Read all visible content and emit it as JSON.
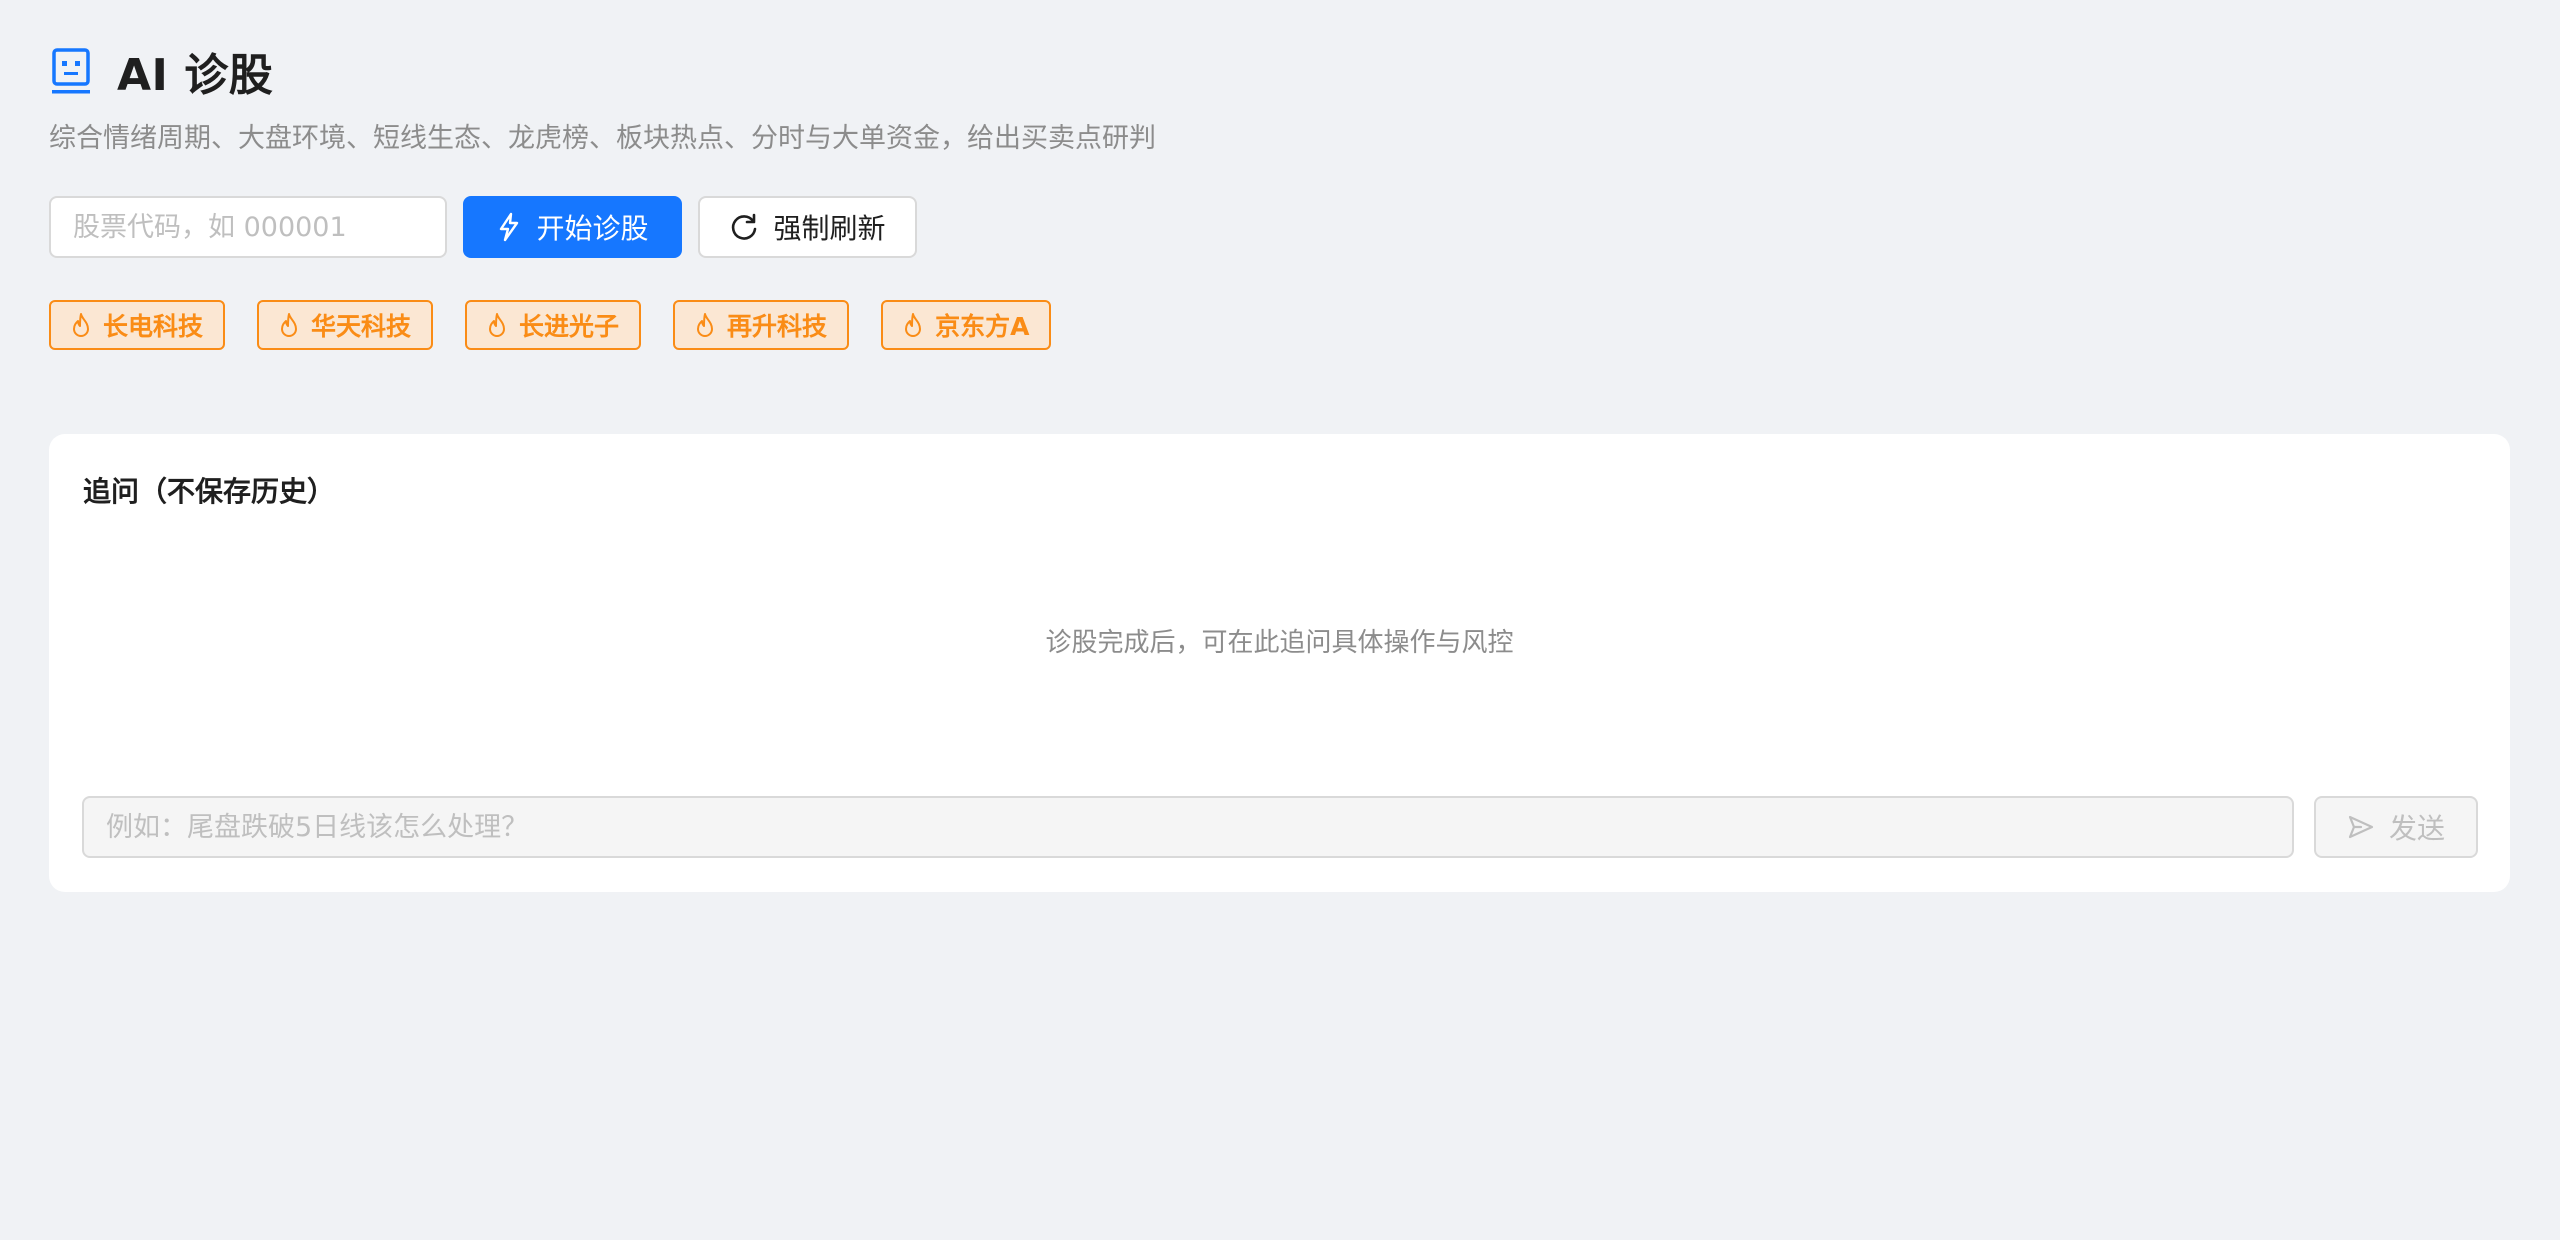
{
  "header": {
    "title": "AI 诊股",
    "logo_icon": "robot-icon",
    "subtitle": "综合情绪周期、大盘环境、短线生态、龙虎榜、板块热点、分时与大单资金，给出买卖点研判"
  },
  "controls": {
    "code_input": {
      "value": "",
      "placeholder": "股票代码，如 000001"
    },
    "start_button": {
      "label": "开始诊股",
      "icon": "lightning-icon"
    },
    "refresh_button": {
      "label": "强制刷新",
      "icon": "reload-icon"
    }
  },
  "hot_stocks": {
    "icon": "fire-icon",
    "items": [
      {
        "label": "长电科技"
      },
      {
        "label": "华天科技"
      },
      {
        "label": "长进光子"
      },
      {
        "label": "再升科技"
      },
      {
        "label": "京东方A"
      }
    ]
  },
  "followup": {
    "title": "追问（不保存历史）",
    "empty_hint": "诊股完成后，可在此追问具体操作与风控",
    "input": {
      "value": "",
      "placeholder": "例如：尾盘跌破5日线该怎么处理？"
    },
    "send_button": {
      "label": "发送",
      "icon": "send-icon",
      "disabled": true
    }
  },
  "colors": {
    "primary": "#1677ff",
    "hot_tag": "#fa8c16",
    "hot_tag_bg": "#fbe7d3",
    "page_bg": "#f0f2f5"
  }
}
